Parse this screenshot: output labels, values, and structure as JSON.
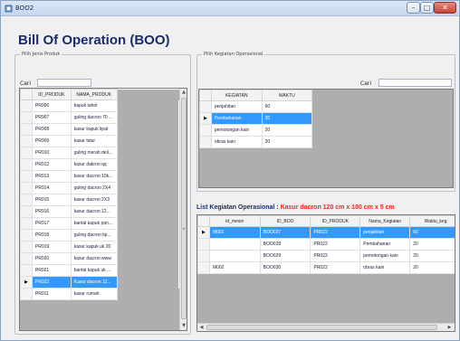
{
  "window": {
    "title": "BOO2",
    "min_label": "–",
    "max_label": "□",
    "close_label": "✕"
  },
  "heading": "Bill Of Operation (BOO)",
  "produk_group": {
    "legend": "Pilih Jenis Produk",
    "search_label": "Cari",
    "search_value": "",
    "columns": [
      "ID_PRODUK",
      "NAMA_PRODUK"
    ],
    "rows": [
      [
        "PR006",
        "kapuk tahol"
      ],
      [
        "PR007",
        "guling dacron 70 ..."
      ],
      [
        "PR008",
        "kasur kapuk lipat"
      ],
      [
        "PR009",
        "kasur tidur"
      ],
      [
        "PR010",
        "guling merah deli..."
      ],
      [
        "PR012",
        "kasur dakron qq"
      ],
      [
        "PR013",
        "kasur dacron 10k..."
      ],
      [
        "PR014",
        "guling dacron 2X4"
      ],
      [
        "PR015",
        "kasur dacron 2X3"
      ],
      [
        "PR016",
        "kasur dacron 12..."
      ],
      [
        "PR017",
        "bantal kapuk pan..."
      ],
      [
        "PR018",
        "guling dacron tip..."
      ],
      [
        "PR019",
        "kasur kapuk uk 20"
      ],
      [
        "PR020",
        "kasur dacron www"
      ],
      [
        "PR021",
        "bantal kapuk uk ..."
      ],
      [
        "PR022",
        "Kasur dacron 12..."
      ],
      [
        "PR011",
        "kasur rumah"
      ]
    ],
    "selected_row": 15
  },
  "kegiatan_group": {
    "legend": "Pilih Kegiatan Operasional",
    "search_label": "Cari",
    "search_value": "",
    "columns": [
      "KEGIATAN",
      "WAKTU"
    ],
    "rows": [
      [
        "penjahitan",
        "60"
      ],
      [
        "Pembahanan",
        "20"
      ],
      [
        "pemotongan kain",
        "20"
      ],
      [
        "obras kain",
        "20"
      ]
    ],
    "selected_row": 1
  },
  "list_kegiatan": {
    "label": "List Kegiatan Operasional :",
    "product": "Kasur dacron 120 cm x 180 cm x 5 cm",
    "columns": [
      "id_mesin",
      "ID_BOO",
      "ID_PRODUK",
      "Nama_Kegiatan",
      "Waktu_keg"
    ],
    "rows": [
      [
        "M001",
        "BOO027",
        "PR022",
        "penjahitan",
        "60"
      ],
      [
        "",
        "BOO028",
        "PR022",
        "Pembahanan",
        "20"
      ],
      [
        "",
        "BOO029",
        "PR022",
        "pemotongan kain",
        "20"
      ],
      [
        "M002",
        "BOO030",
        "PR022",
        "obras kain",
        "20"
      ]
    ]
  },
  "icons": {
    "current_row": "▶",
    "scroll_up": "▲",
    "scroll_down": "▼",
    "scroll_left": "◀",
    "scroll_right": "▶",
    "grip": "≡"
  },
  "colors": {
    "heading": "#1a2c6b",
    "selection": "#3399ff",
    "highlight": "#e8281e"
  }
}
